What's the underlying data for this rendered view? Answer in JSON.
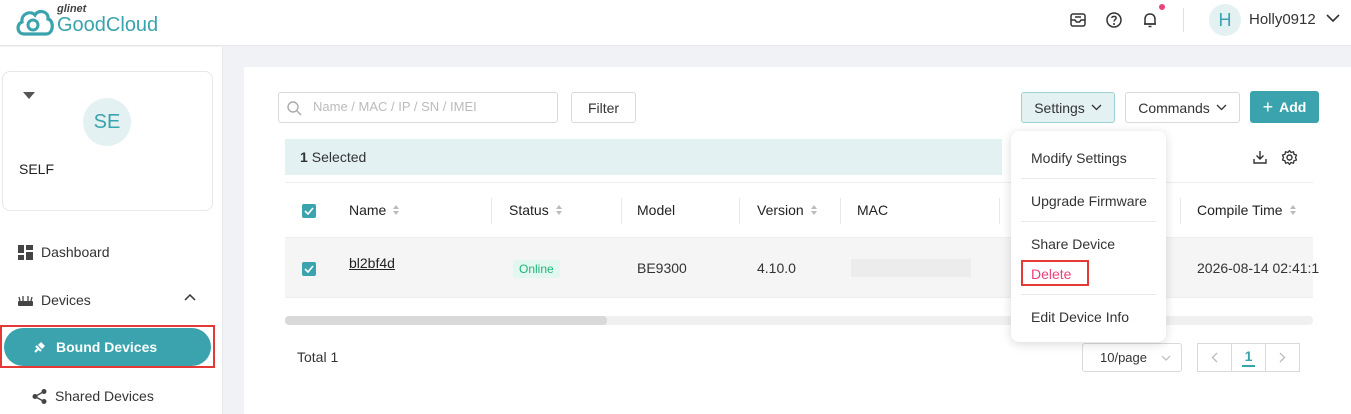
{
  "brand": {
    "small": "glinet",
    "big": "GoodCloud"
  },
  "header": {
    "avatar_initial": "H",
    "username": "Holly0912"
  },
  "org": {
    "avatar": "SE",
    "name": "SELF"
  },
  "nav": {
    "dashboard": "Dashboard",
    "devices": "Devices",
    "bound_devices": "Bound Devices",
    "shared_devices": "Shared Devices"
  },
  "toolbar": {
    "search_placeholder": "Name / MAC / IP / SN / IMEI",
    "filter": "Filter",
    "settings": "Settings",
    "commands": "Commands",
    "add": "Add"
  },
  "selection": {
    "count": "1",
    "label": "Selected"
  },
  "table": {
    "columns": {
      "name": "Name",
      "status": "Status",
      "model": "Model",
      "version": "Version",
      "mac": "MAC",
      "compile_time": "Compile Time"
    },
    "rows": [
      {
        "name": "bl2bf4d",
        "status": "Online",
        "model": "BE9300",
        "version": "4.10.0",
        "compile_time": "2026-08-14 02:41:1"
      }
    ]
  },
  "footer": {
    "total": "Total 1",
    "page_size": "10/page",
    "current_page": "1"
  },
  "settings_menu": {
    "items": [
      "Modify Settings",
      "Upgrade Firmware",
      "Share Device",
      "Delete",
      "Edit Device Info"
    ]
  },
  "colors": {
    "accent": "#3aa3ae",
    "danger": "#e8447b",
    "online": "#1fb578",
    "highlight": "#e53935"
  }
}
